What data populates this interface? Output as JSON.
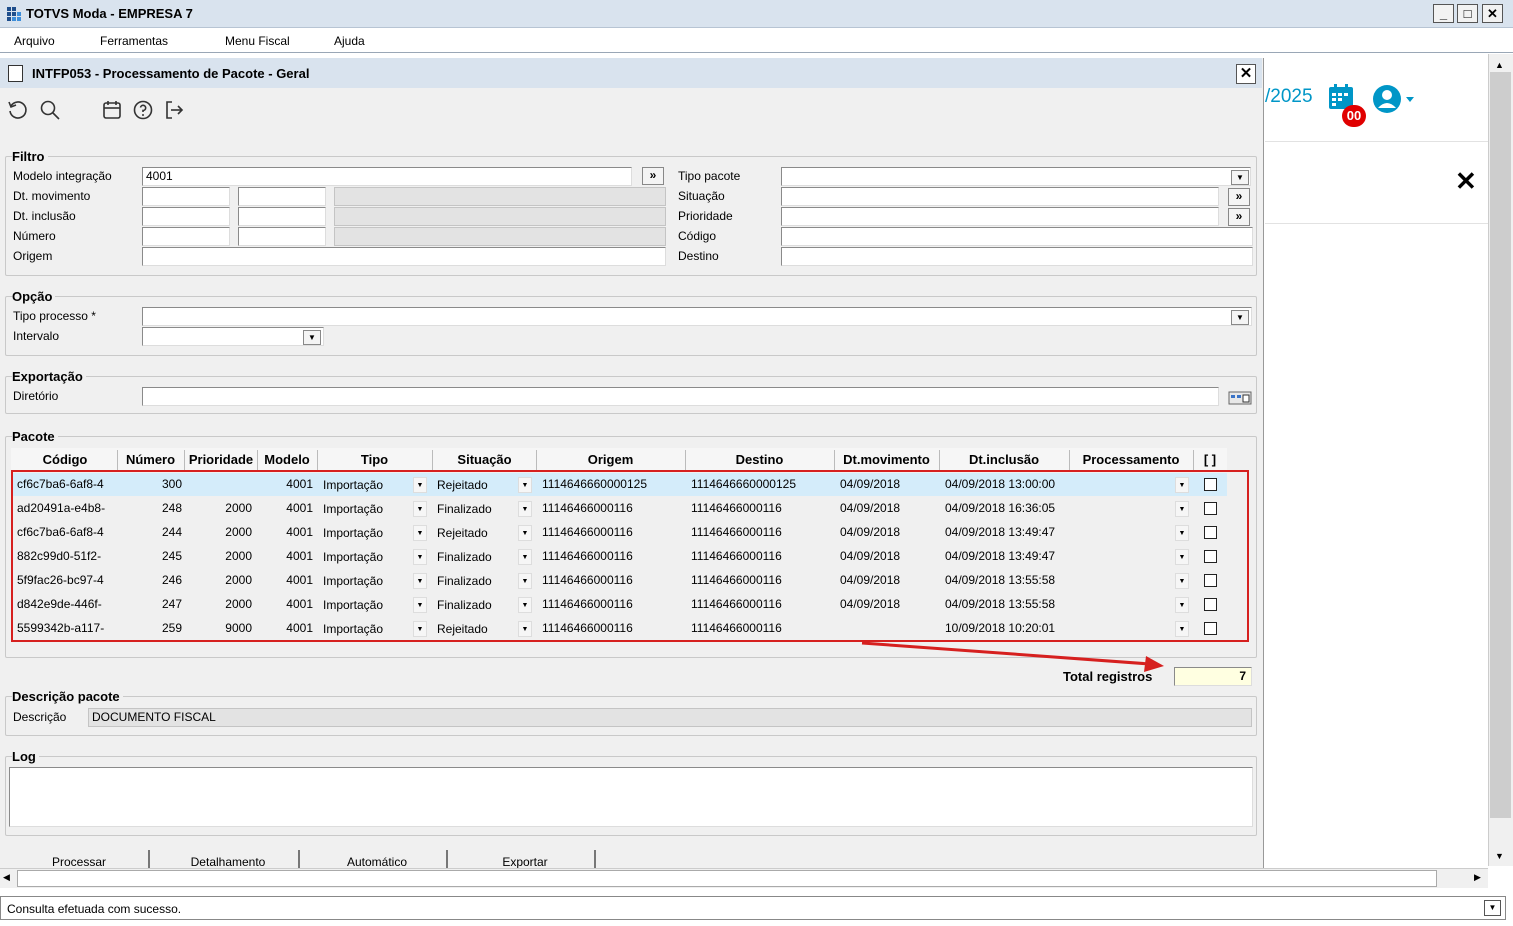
{
  "window": {
    "title": "TOTVS Moda - EMPRESA 7",
    "min": "_",
    "max": "□",
    "close": "✕"
  },
  "menu": [
    "Arquivo",
    "Ferramentas",
    "Menu Fiscal",
    "Ajuda"
  ],
  "dialog": {
    "title": "INTFP053 - Processamento de Pacote - Geral",
    "close": "✕"
  },
  "filtro": {
    "label": "Filtro",
    "modelo_label": "Modelo integração",
    "modelo_value": "4001",
    "dtmov_label": "Dt. movimento",
    "dtinc_label": "Dt. inclusão",
    "numero_label": "Número",
    "origem_label": "Origem",
    "tipo_pacote_label": "Tipo pacote",
    "situacao_label": "Situação",
    "prioridade_label": "Prioridade",
    "codigo_label": "Código",
    "destino_label": "Destino",
    "lookup": "»"
  },
  "opcao": {
    "label": "Opção",
    "tipo_label": "Tipo processo *",
    "intervalo_label": "Intervalo"
  },
  "exportacao": {
    "label": "Exportação",
    "diretorio_label": "Diretório"
  },
  "pacote": {
    "label": "Pacote",
    "headers": [
      "Código",
      "Número",
      "Prioridade",
      "Modelo",
      "Tipo",
      "Situação",
      "Origem",
      "Destino",
      "Dt.movimento",
      "Dt.inclusão",
      "Processamento",
      "[ ]"
    ],
    "rows": [
      {
        "codigo": "cf6c7ba6-6af8-4",
        "numero": "300",
        "prioridade": "",
        "modelo": "4001",
        "tipo": "Importação",
        "situacao": "Rejeitado",
        "origem": "1114646660000125",
        "destino": "1114646660000125",
        "dtmov": "04/09/2018",
        "dtinc": "04/09/2018 13:00:00"
      },
      {
        "codigo": "ad20491a-e4b8-",
        "numero": "248",
        "prioridade": "2000",
        "modelo": "4001",
        "tipo": "Importação",
        "situacao": "Finalizado",
        "origem": "11146466000116",
        "destino": "11146466000116",
        "dtmov": "04/09/2018",
        "dtinc": "04/09/2018 16:36:05"
      },
      {
        "codigo": "cf6c7ba6-6af8-4",
        "numero": "244",
        "prioridade": "2000",
        "modelo": "4001",
        "tipo": "Importação",
        "situacao": "Rejeitado",
        "origem": "11146466000116",
        "destino": "11146466000116",
        "dtmov": "04/09/2018",
        "dtinc": "04/09/2018 13:49:47"
      },
      {
        "codigo": "882c99d0-51f2-",
        "numero": "245",
        "prioridade": "2000",
        "modelo": "4001",
        "tipo": "Importação",
        "situacao": "Finalizado",
        "origem": "11146466000116",
        "destino": "11146466000116",
        "dtmov": "04/09/2018",
        "dtinc": "04/09/2018 13:49:47"
      },
      {
        "codigo": "5f9fac26-bc97-4",
        "numero": "246",
        "prioridade": "2000",
        "modelo": "4001",
        "tipo": "Importação",
        "situacao": "Finalizado",
        "origem": "11146466000116",
        "destino": "11146466000116",
        "dtmov": "04/09/2018",
        "dtinc": "04/09/2018 13:55:58"
      },
      {
        "codigo": "d842e9de-446f-",
        "numero": "247",
        "prioridade": "2000",
        "modelo": "4001",
        "tipo": "Importação",
        "situacao": "Finalizado",
        "origem": "11146466000116",
        "destino": "11146466000116",
        "dtmov": "04/09/2018",
        "dtinc": "04/09/2018 13:55:58"
      },
      {
        "codigo": "5599342b-a117-",
        "numero": "259",
        "prioridade": "9000",
        "modelo": "4001",
        "tipo": "Importação",
        "situacao": "Rejeitado",
        "origem": "11146466000116",
        "destino": "11146466000116",
        "dtmov": "",
        "dtinc": "10/09/2018 10:20:01"
      }
    ],
    "total_label": "Total registros",
    "total_value": "7"
  },
  "descricao": {
    "label": "Descrição pacote",
    "field_label": "Descrição",
    "value": "DOCUMENTO FISCAL"
  },
  "log": {
    "label": "Log"
  },
  "buttons": [
    "Processar",
    "Detalhamento",
    "Automático",
    "Exportar"
  ],
  "right": {
    "date": "/2025",
    "badge": "00",
    "close": "✕"
  },
  "status": {
    "text": "Consulta efetuada com sucesso."
  },
  "colors": {
    "accent": "#0096c7",
    "badge": "#e00000",
    "highlight": "#d4ecfa",
    "total_bg": "#ffffe1",
    "annotation": "#d6201f"
  }
}
